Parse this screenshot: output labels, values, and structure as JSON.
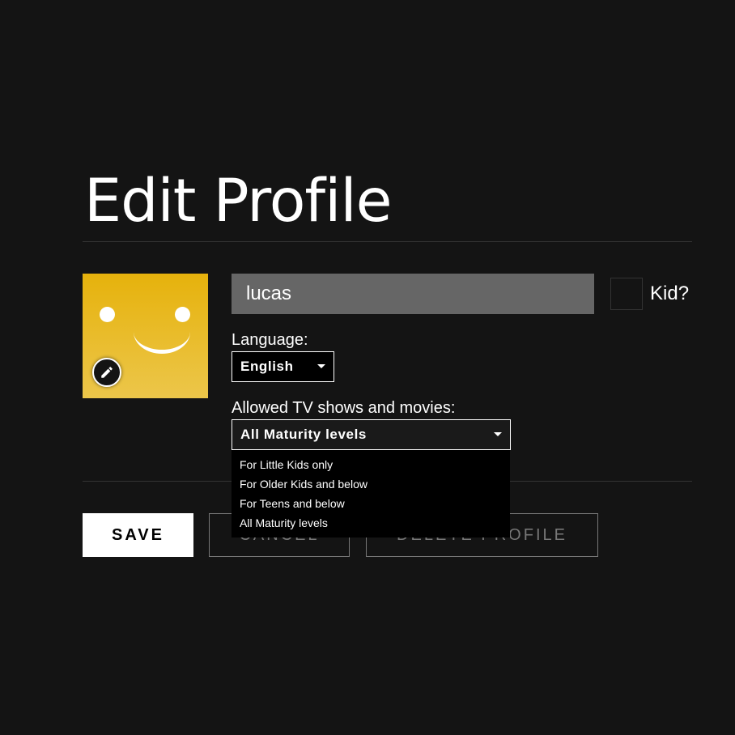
{
  "page": {
    "title": "Edit Profile"
  },
  "profile": {
    "name_value": "lucas",
    "kid_label": "Kid?",
    "kid_checked": false,
    "avatar_color": "#e6b20c",
    "avatar_icon": "smiley-face-icon",
    "edit_icon": "pencil-icon"
  },
  "language": {
    "label": "Language:",
    "selected": "English"
  },
  "maturity": {
    "label": "Allowed TV shows and movies:",
    "selected": "All Maturity levels",
    "options": [
      "For Little Kids only",
      "For Older Kids and below",
      "For Teens and below",
      "All Maturity levels"
    ]
  },
  "buttons": {
    "save": "SAVE",
    "cancel": "CANCEL",
    "delete": "DELETE PROFILE"
  }
}
